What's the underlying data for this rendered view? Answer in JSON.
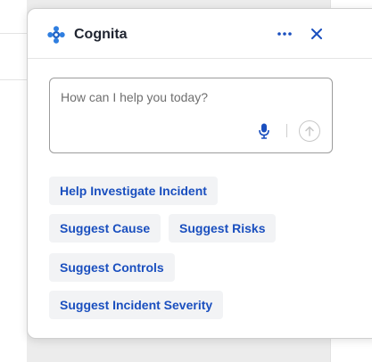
{
  "widget": {
    "title": "Cognita",
    "input": {
      "placeholder": "How can I help you today?"
    },
    "suggestions": [
      "Help Investigate Incident",
      "Suggest Cause",
      "Suggest Risks",
      "Suggest Controls",
      "Suggest Incident Severity"
    ]
  },
  "icons": {
    "logo": "cognita-logo-icon",
    "more": "more-dots-icon",
    "close": "close-icon",
    "mic": "microphone-icon",
    "send": "send-arrow-icon",
    "drag": "drag-handle-icon"
  },
  "colors": {
    "accent": "#1a4fbf",
    "logo": "#2f7ee0"
  }
}
